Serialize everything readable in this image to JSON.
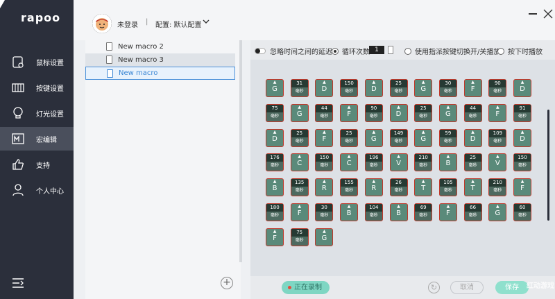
{
  "app": {
    "brand": "rapoo"
  },
  "nav": [
    {
      "id": "mouse",
      "icon": "mouse-settings-icon",
      "label": "鼠标设置"
    },
    {
      "id": "keys",
      "icon": "key-settings-icon",
      "label": "按键设置"
    },
    {
      "id": "light",
      "icon": "bulb-icon",
      "label": "灯光设置"
    },
    {
      "id": "macro",
      "icon": "macro-edit-icon",
      "label": "宏编辑",
      "active": true
    },
    {
      "id": "support",
      "icon": "thumbs-up-icon",
      "label": "支持"
    },
    {
      "id": "profile",
      "icon": "user-icon",
      "label": "个人中心"
    }
  ],
  "header": {
    "user": "未登录",
    "separator": "|",
    "config": "配置: 默认配置"
  },
  "macro_list": [
    {
      "name": "New macro 2"
    },
    {
      "name": "New macro 3"
    },
    {
      "name": "New macro"
    }
  ],
  "options": {
    "ignore_delay": "忽略时间之间的延迟",
    "loop_count_label": "循环次数",
    "loop_count": "1",
    "toggle_mode": "使用指派按键切换开/关播放",
    "hold_mode": "按下时播放"
  },
  "unit": "毫秒",
  "tiles": [
    [
      "k",
      "G"
    ],
    [
      "d",
      "31"
    ],
    [
      "k",
      "D"
    ],
    [
      "d",
      "150"
    ],
    [
      "k",
      "D"
    ],
    [
      "d",
      "25"
    ],
    [
      "k",
      "G"
    ],
    [
      "d",
      "30"
    ],
    [
      "k",
      "F"
    ],
    [
      "d",
      "90"
    ],
    [
      "k",
      "D"
    ],
    [
      "d",
      "75"
    ],
    [
      "k",
      "G"
    ],
    [
      "d",
      "44"
    ],
    [
      "k",
      "F"
    ],
    [
      "d",
      "90"
    ],
    [
      "k",
      "D"
    ],
    [
      "d",
      "25"
    ],
    [
      "k",
      "G"
    ],
    [
      "d",
      "44"
    ],
    [
      "k",
      "F"
    ],
    [
      "d",
      "91"
    ],
    [
      "k",
      "D"
    ],
    [
      "d",
      "25"
    ],
    [
      "k",
      "F"
    ],
    [
      "d",
      "25"
    ],
    [
      "k",
      "G"
    ],
    [
      "d",
      "149"
    ],
    [
      "k",
      "G"
    ],
    [
      "d",
      "59"
    ],
    [
      "k",
      "D"
    ],
    [
      "d",
      "109"
    ],
    [
      "k",
      "D"
    ],
    [
      "d",
      "176"
    ],
    [
      "k",
      "C"
    ],
    [
      "d",
      "150"
    ],
    [
      "k",
      "C"
    ],
    [
      "d",
      "196"
    ],
    [
      "k",
      "V"
    ],
    [
      "d",
      "210"
    ],
    [
      "k",
      "B"
    ],
    [
      "d",
      "25"
    ],
    [
      "k",
      "V"
    ],
    [
      "d",
      "150"
    ],
    [
      "k",
      "B"
    ],
    [
      "d",
      "135"
    ],
    [
      "k",
      "R"
    ],
    [
      "d",
      "155"
    ],
    [
      "k",
      "R"
    ],
    [
      "d",
      "26"
    ],
    [
      "k",
      "T"
    ],
    [
      "d",
      "105"
    ],
    [
      "k",
      "T"
    ],
    [
      "d",
      "210"
    ],
    [
      "k",
      "F"
    ],
    [
      "d",
      "180"
    ],
    [
      "k",
      "F"
    ],
    [
      "d",
      "30"
    ],
    [
      "k",
      "B"
    ],
    [
      "d",
      "104"
    ],
    [
      "k",
      "B"
    ],
    [
      "d",
      "69"
    ],
    [
      "k",
      "F"
    ],
    [
      "d",
      "66"
    ],
    [
      "k",
      "G"
    ],
    [
      "d",
      "60"
    ],
    [
      "k",
      "F"
    ],
    [
      "d",
      "75"
    ],
    [
      "k",
      "G"
    ]
  ],
  "footer": {
    "recording": "正在录制",
    "redo": "↻",
    "cancel": "取消",
    "save": "保存",
    "watermark": "红动游戏"
  }
}
